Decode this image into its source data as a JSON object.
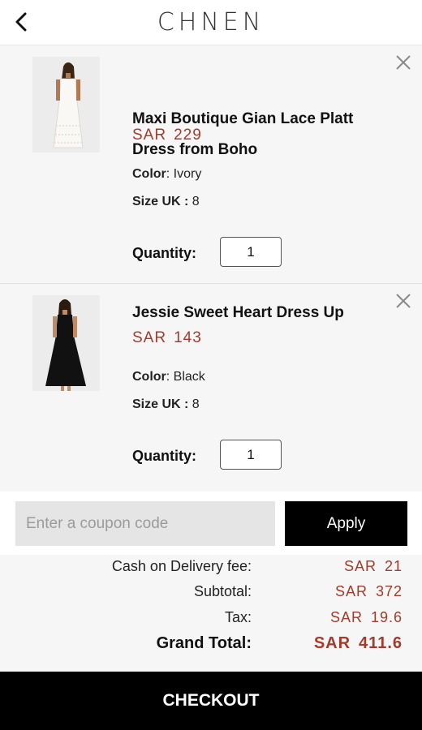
{
  "header": {
    "logo": "CHNEN",
    "back_icon": "chevron-left-icon"
  },
  "items": [
    {
      "title": "Maxi Boutique Gian Lace Platt Dress from Boho",
      "currency": "SAR",
      "price": "229",
      "color_label": "Color",
      "color_value": "Ivory",
      "size_label": "Size UK :",
      "size_value": "8",
      "qty_label": "Quantity:",
      "qty_value": "1",
      "dress_color": "#f4f1ec"
    },
    {
      "title": "Jessie Sweet Heart Dress Up",
      "currency": "SAR",
      "price": "143",
      "color_label": "Color",
      "color_value": "Black",
      "size_label": "Size UK :",
      "size_value": "8",
      "qty_label": "Quantity:",
      "qty_value": "1",
      "dress_color": "#111111"
    }
  ],
  "coupon": {
    "placeholder": "Enter a coupon code",
    "apply_label": "Apply"
  },
  "totals": {
    "cod_label": "Cash on Delivery fee:",
    "cod_currency": "SAR",
    "cod_value": "21",
    "subtotal_label": "Subtotal:",
    "subtotal_currency": "SAR",
    "subtotal_value": "372",
    "tax_label": "Tax:",
    "tax_currency": "SAR",
    "tax_value": "19.6",
    "grand_label": "Grand Total:",
    "grand_currency": "SAR",
    "grand_value": "411.6"
  },
  "checkout_label": "CHECKOUT",
  "colors": {
    "price": "#a33b2a",
    "primary_button": "#000000"
  }
}
